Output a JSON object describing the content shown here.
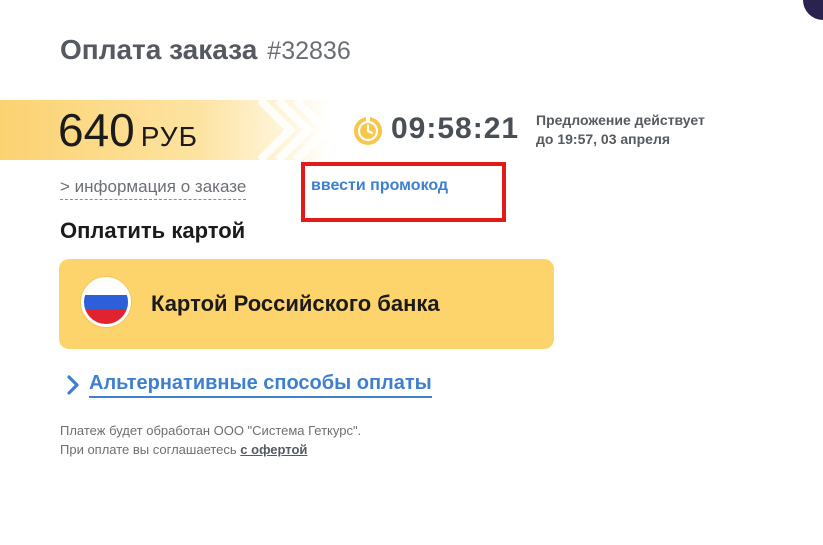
{
  "order": {
    "title": "Оплата заказа",
    "number": "#32836"
  },
  "price": {
    "amount": "640",
    "currency": "РУБ"
  },
  "timer": {
    "value": "09:58:21",
    "icon": "stopwatch-icon"
  },
  "offer": {
    "line1": "Предложение действует",
    "line2": "до 19:57, 03 апреля"
  },
  "links": {
    "info": "> информация о заказе",
    "promo": "ввести промокод",
    "alternative": "Альтернативные способы оплаты"
  },
  "payment": {
    "heading": "Оплатить картой",
    "card_button_label": "Картой Российского банка",
    "flag_icon": "russia-flag-icon"
  },
  "footer": {
    "line1": "Платеж будет обработан ООО \"Система Геткурс\".",
    "line2_prefix": "При оплате вы соглашаетесь ",
    "offer_link": "с офертой"
  },
  "colors": {
    "accent_yellow": "#fdd36c",
    "link_blue": "#3f7fd0",
    "highlight_red": "#e21a1a",
    "title_gray": "#555a60"
  }
}
